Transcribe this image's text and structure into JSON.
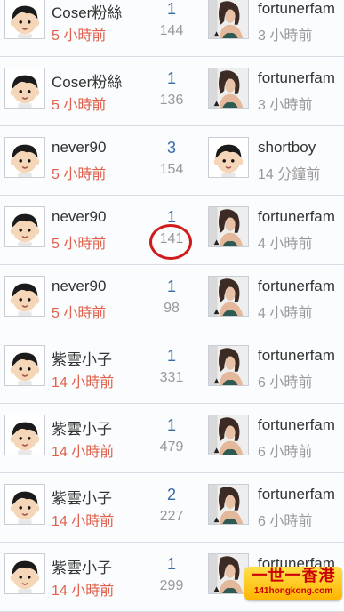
{
  "rows": [
    {
      "author": "Coser粉絲",
      "author_time": "5 小時前",
      "replies": "1",
      "views": "144",
      "last_user": "fortunerfam",
      "last_time": "3 小時前",
      "last_avatar": "woman-photo"
    },
    {
      "author": "Coser粉絲",
      "author_time": "5 小時前",
      "replies": "1",
      "views": "136",
      "last_user": "fortunerfam",
      "last_time": "3 小時前",
      "last_avatar": "woman-photo"
    },
    {
      "author": "never90",
      "author_time": "5 小時前",
      "replies": "3",
      "views": "154",
      "last_user": "shortboy",
      "last_time": "14 分鐘前",
      "last_avatar": "cartoon-boy"
    },
    {
      "author": "never90",
      "author_time": "5 小時前",
      "replies": "1",
      "views": "141",
      "last_user": "fortunerfam",
      "last_time": "4 小時前",
      "last_avatar": "woman-photo",
      "highlight": true
    },
    {
      "author": "never90",
      "author_time": "5 小時前",
      "replies": "1",
      "views": "98",
      "last_user": "fortunerfam",
      "last_time": "4 小時前",
      "last_avatar": "woman-photo"
    },
    {
      "author": "紫雲小子",
      "author_time": "14 小時前",
      "replies": "1",
      "views": "331",
      "last_user": "fortunerfam",
      "last_time": "6 小時前",
      "last_avatar": "woman-photo"
    },
    {
      "author": "紫雲小子",
      "author_time": "14 小時前",
      "replies": "1",
      "views": "479",
      "last_user": "fortunerfam",
      "last_time": "6 小時前",
      "last_avatar": "woman-photo"
    },
    {
      "author": "紫雲小子",
      "author_time": "14 小時前",
      "replies": "2",
      "views": "227",
      "last_user": "fortunerfam",
      "last_time": "6 小時前",
      "last_avatar": "woman-photo"
    },
    {
      "author": "紫雲小子",
      "author_time": "14 小時前",
      "replies": "1",
      "views": "299",
      "last_user": "fortunerfam",
      "last_time": "6 小時前",
      "last_avatar": "woman-photo"
    }
  ],
  "watermark": {
    "title": "一世一香港",
    "site": "141hongkong.com"
  },
  "colors": {
    "author_time": "#e0604b",
    "replies": "#3a6aa6",
    "muted": "#999999",
    "highlight_circle": "#d11a1a"
  }
}
